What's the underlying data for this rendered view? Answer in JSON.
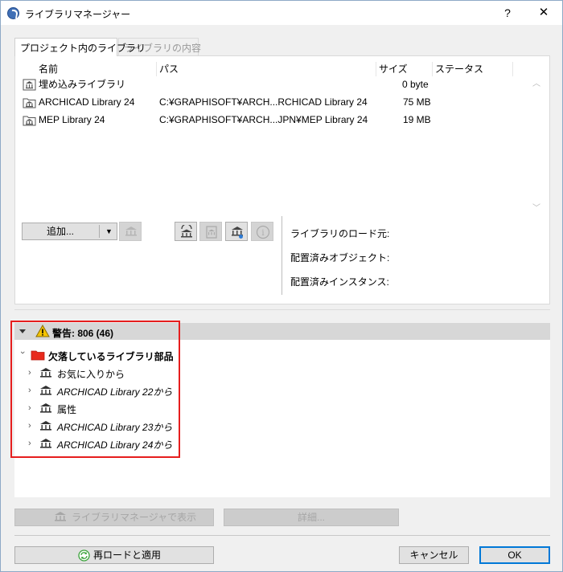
{
  "window": {
    "title": "ライブラリマネージャー",
    "help_label": "?",
    "close_label": "✕"
  },
  "tabs": [
    {
      "label": "プロジェクト内のライブラリ",
      "active": true
    },
    {
      "label": "ライブラリの内容",
      "active": false
    }
  ],
  "library_table": {
    "columns": [
      "名前",
      "パス",
      "サイズ",
      "ステータス"
    ],
    "rows": [
      {
        "name": "埋め込みライブラリ",
        "path": "",
        "size": "0 byte",
        "status": ""
      },
      {
        "name": "ARCHICAD Library 24",
        "path": "C:¥GRAPHISOFT¥ARCH...RCHICAD Library 24",
        "size": "75 MB",
        "status": ""
      },
      {
        "name": "MEP Library 24",
        "path": "C:¥GRAPHISOFT¥ARCH...JPN¥MEP Library 24",
        "size": "19 MB",
        "status": ""
      }
    ]
  },
  "toolbar": {
    "add_label": "追加...",
    "dropdown_glyph": "▼",
    "info_glyph": "i"
  },
  "info_panel": {
    "load_source_label": "ライブラリのロード元:",
    "placed_objects_label": "配置済みオブジェクト:",
    "placed_instances_label": "配置済みインスタンス:"
  },
  "warnings": {
    "title": "警告: 806 (46)",
    "group_label": "欠落しているライブラリ部品",
    "items": [
      {
        "label": "お気に入りから",
        "italic": false
      },
      {
        "label": "ARCHICAD Library 22から",
        "italic": true
      },
      {
        "label": "属性",
        "italic": false
      },
      {
        "label": "ARCHICAD Library 23から",
        "italic": true
      },
      {
        "label": "ARCHICAD Library 24から",
        "italic": true
      }
    ]
  },
  "bottom_buttons": {
    "show_in_manager": "ライブラリマネージャで表示",
    "details": "詳細...",
    "reload_apply": "再ロードと適用",
    "cancel": "キャンセル",
    "ok": "OK"
  },
  "colors": {
    "highlight_border": "#e61e1e",
    "folder_red": "#e8291c",
    "warning_yellow": "#f5c400",
    "reload_green": "#3aa33a"
  }
}
